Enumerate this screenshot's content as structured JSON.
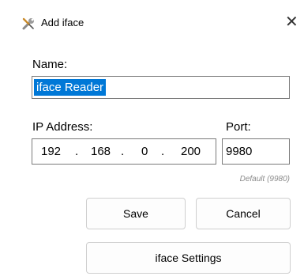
{
  "window": {
    "title": "Add iface",
    "close_glyph": "✕",
    "icon": "tools-icon"
  },
  "form": {
    "name_label": "Name:",
    "name_value": "iface Reader",
    "ip_label": "IP Address:",
    "ip_octets": [
      "192",
      "168",
      "0",
      "200"
    ],
    "ip_separator": ".",
    "port_label": "Port:",
    "port_value": "9980",
    "port_hint": "Default (9980)"
  },
  "buttons": {
    "save": "Save",
    "cancel": "Cancel",
    "settings": "iface Settings"
  },
  "colors": {
    "selection": "#0078d7",
    "hint": "#8a8a8a"
  }
}
